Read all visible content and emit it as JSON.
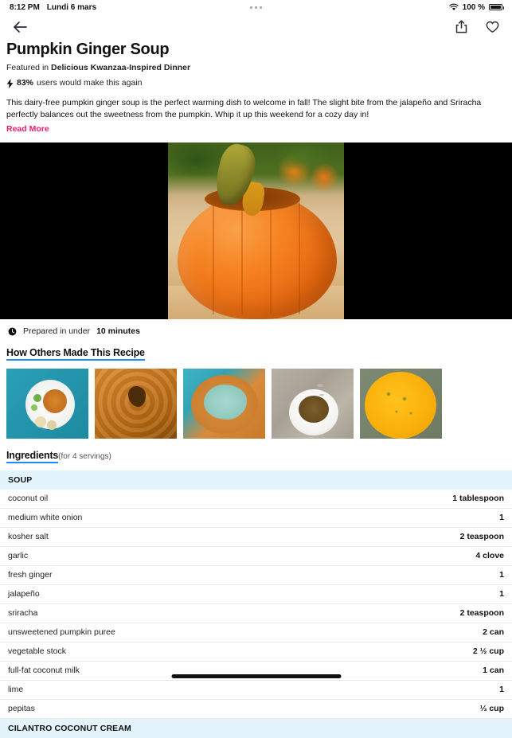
{
  "status_bar": {
    "time": "8:12 PM",
    "date": "Lundi 6 mars",
    "battery_percent": "100 %",
    "wifi_icon": "wifi-icon",
    "battery_icon": "battery-full-icon",
    "dots_icon": "three-dots-icon"
  },
  "nav": {
    "back_icon": "arrow-left-icon",
    "share_icon": "share-icon",
    "favorite_icon": "heart-outline-icon"
  },
  "recipe": {
    "title": "Pumpkin Ginger Soup",
    "featured_prefix": "Featured in ",
    "featured_collection": "Delicious Kwanzaa-Inspired Dinner",
    "rating_icon": "lightning-bolt-icon",
    "rating_percent": "83%",
    "rating_text": "users would make this again",
    "description": "This dairy-free pumpkin ginger soup is the perfect warming dish to welcome in fall! The slight bite from the jalapeño and Sriracha perfectly balances out the sweetness from the pumpkin. Whip it up this weekend for a cozy day in!",
    "read_more": "Read More",
    "hero_alt": "pumpkin-soup-hero-video"
  },
  "prep": {
    "clock_icon": "clock-icon",
    "prefix": "Prepared in under ",
    "time": "10 minutes"
  },
  "community": {
    "heading": "How Others Made This Recipe",
    "thumbnails": [
      {
        "name": "user-photo-1",
        "alt": "soup-bowl-with-salad-on-teal-table"
      },
      {
        "name": "user-photo-2",
        "alt": "creamy-orange-soup-with-bay-leaf"
      },
      {
        "name": "user-photo-3",
        "alt": "soup-with-green-cilantro-cream"
      },
      {
        "name": "user-photo-4",
        "alt": "soup-bowl-with-spoon-on-granite"
      },
      {
        "name": "user-photo-5",
        "alt": "bright-yellow-soup-with-herbs"
      }
    ]
  },
  "ingredients": {
    "heading": "Ingredients",
    "servings": "(for 4 servings)",
    "sections": [
      {
        "title": "SOUP",
        "items": [
          {
            "name": "coconut oil",
            "amount": "1 tablespoon"
          },
          {
            "name": "medium white onion",
            "amount": "1"
          },
          {
            "name": "kosher salt",
            "amount": "2 teaspoon"
          },
          {
            "name": "garlic",
            "amount": "4 clove"
          },
          {
            "name": "fresh ginger",
            "amount": "1"
          },
          {
            "name": "jalapeño",
            "amount": "1"
          },
          {
            "name": " sriracha",
            "amount": "2 teaspoon"
          },
          {
            "name": "unsweetened pumpkin puree",
            "amount": "2 can"
          },
          {
            "name": "vegetable stock",
            "amount": "2 ½ cup"
          },
          {
            "name": "full-fat coconut milk",
            "amount": "1 can"
          },
          {
            "name": "lime",
            "amount": "1"
          },
          {
            "name": "pepitas",
            "amount": "⅓ cup"
          }
        ]
      },
      {
        "title": "CILANTRO COCONUT CREAM",
        "items": []
      }
    ]
  },
  "colors": {
    "accent_pink": "#ee1d6a",
    "accent_blue": "#1a8cff",
    "section_bg": "#e3f4fc"
  }
}
